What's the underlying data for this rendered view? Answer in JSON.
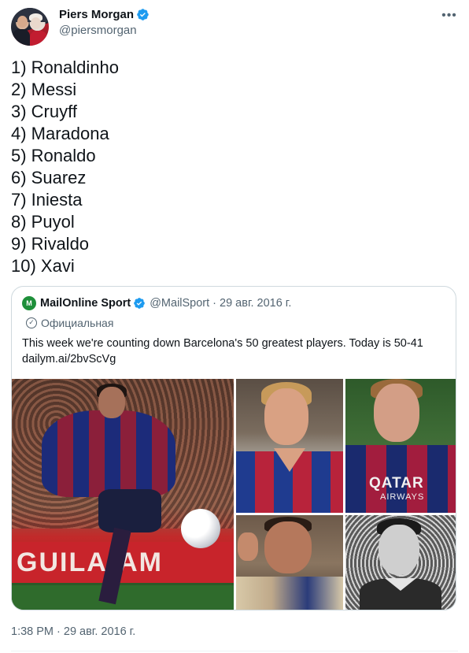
{
  "author": {
    "name": "Piers Morgan",
    "handle": "@piersmorgan"
  },
  "more_icon": "more-horizontal-icon",
  "tweet_lines": [
    "1) Ronaldinho",
    "2) Messi",
    "3) Cruyff",
    "4) Maradona",
    "5) Ronaldo",
    "6) Suarez",
    "7) Iniesta",
    "8) Puyol",
    "9) Rivaldo",
    "10) Xavi"
  ],
  "quoted": {
    "logo_text": "M",
    "name": "MailOnline Sport",
    "handle": "@MailSport",
    "separator": "·",
    "date": "29 авг. 2016 г.",
    "label": "Официальная",
    "text": "This week we're counting down Barcelona's 50 greatest players. Today is 50-41",
    "link": "dailym.ai/2bvScVg",
    "photo1_banner": "GUILA-AM",
    "photo3_sponsor": "QATAR",
    "photo3_sponsor_sub": "AIRWAYS"
  },
  "timestamp": "1:38 PM · 29 авг. 2016 г.",
  "colors": {
    "verified": "#1d9bf0",
    "secondary_text": "#536471",
    "border": "#cfd9de"
  }
}
